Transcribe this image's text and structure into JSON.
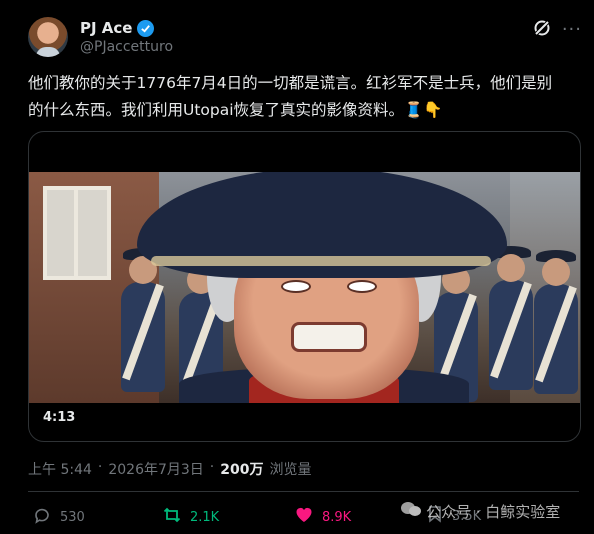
{
  "author": {
    "name": "PJ Ace",
    "handle": "@PJaccetturo"
  },
  "tweet": {
    "text_line1": "他们教你的关于1776年7月4日的一切都是谎言。红衫军不是士兵，他们是别",
    "text_line2": "的什么东西。我们利用Utopai恢复了真实的影像资料。🧵👇"
  },
  "media": {
    "duration": "4:13"
  },
  "meta": {
    "time": "上午 5:44",
    "date": "2026年7月3日",
    "views": "200万",
    "views_label": "浏览量"
  },
  "actions": {
    "replies": "530",
    "retweets": "2.1K",
    "likes": "8.9K",
    "bookmarks": "3.5K"
  },
  "watermark": "公众号 · 白鲸实验室",
  "colors": {
    "accent": "#1d9bf0",
    "retweet": "#00ba7c",
    "like": "#f91880",
    "muted": "#71767b"
  }
}
